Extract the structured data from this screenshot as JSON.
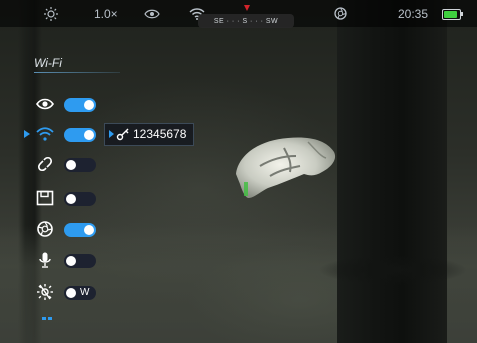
{
  "status_bar": {
    "zoom": "1.0×",
    "compass": "SE · · · S · · · SW",
    "time": "20:35",
    "battery_level": 0.85,
    "icons": [
      "brightness-icon",
      "eye-icon",
      "wifi-icon",
      "compass-marker-icon",
      "shutter-icon",
      "battery-icon"
    ]
  },
  "menu": {
    "title": "Wi-Fi",
    "items": [
      {
        "name": "visibility",
        "icon": "eye-icon",
        "state": "on",
        "selected": false
      },
      {
        "name": "wifi",
        "icon": "wifi-icon",
        "state": "on",
        "selected": true
      },
      {
        "name": "link",
        "icon": "link-icon",
        "state": "off",
        "selected": false
      },
      {
        "name": "save",
        "icon": "save-icon",
        "state": "off",
        "selected": false
      },
      {
        "name": "shutter",
        "icon": "shutter-icon",
        "state": "on",
        "selected": false
      },
      {
        "name": "microphone",
        "icon": "microphone-icon",
        "state": "off",
        "selected": false
      },
      {
        "name": "white-hot",
        "icon": "sun-off-icon",
        "state": "off",
        "label": "W",
        "selected": false
      }
    ],
    "wifi_password": "12345678"
  },
  "colors": {
    "accent": "#2e9bf0",
    "battery": "#3fd03f",
    "compass_marker": "#d2232a"
  }
}
